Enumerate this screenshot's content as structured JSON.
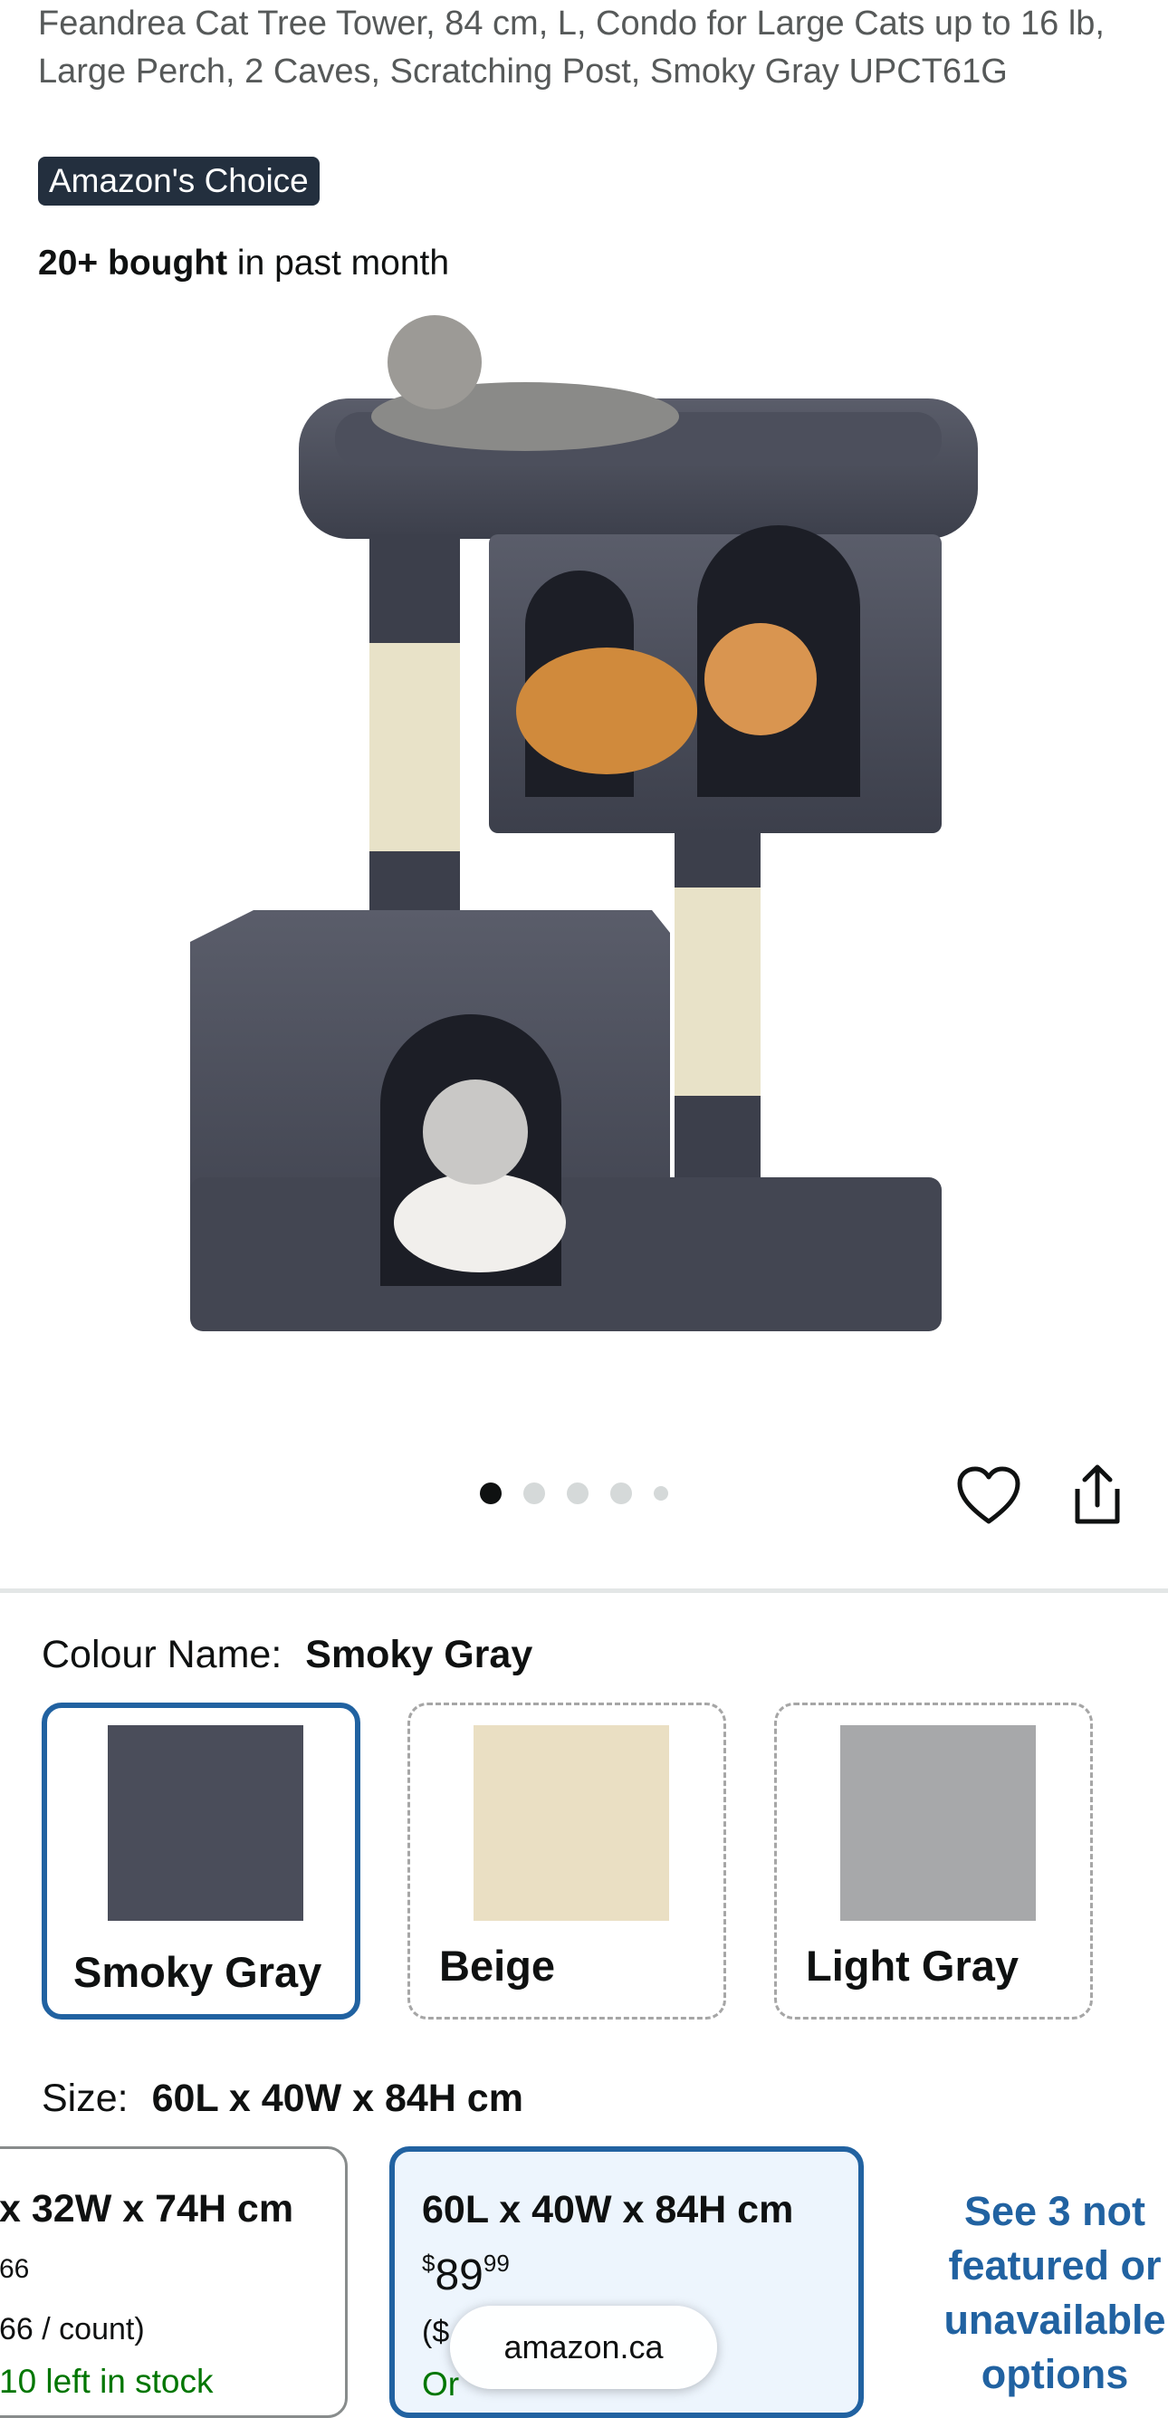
{
  "product": {
    "title": "Feandrea Cat Tree Tower, 84 cm, L, Condo for Large Cats up to 16 lb, Large Perch, 2 Caves, Scratching Post, Smoky Gray UPCT61G",
    "badge": "Amazon's Choice",
    "bought_bold": "20+ bought",
    "bought_rest": " in past month"
  },
  "carousel": {
    "total_dots": 5,
    "active_index": 0
  },
  "colour": {
    "label": "Colour Name:",
    "selected": "Smoky Gray",
    "options": [
      {
        "label": "Smoky Gray",
        "color": "#4a4d5a"
      },
      {
        "label": "Beige",
        "color": "#eadfc3"
      },
      {
        "label": "Light Gray",
        "color": "#a7a8aa"
      }
    ]
  },
  "size": {
    "label": "Size:",
    "selected": "60L x 40W x 84H cm",
    "options": [
      {
        "dim": "x 32W x 74H cm",
        "price_cents": "66",
        "unit": "66 / count)",
        "stock": "10 left in stock"
      },
      {
        "dim": "60L x 40W x 84H cm",
        "price_currency": "$",
        "price_whole": "89",
        "price_cents": "99",
        "unit": "($",
        "stock": "Or"
      }
    ],
    "see_more": "See 3 not featured or unavailable options"
  },
  "browser": {
    "url": "amazon.ca"
  },
  "colors": {
    "accent": "#2162a1",
    "badge_bg": "#232f3e",
    "stock_green": "#007600"
  }
}
